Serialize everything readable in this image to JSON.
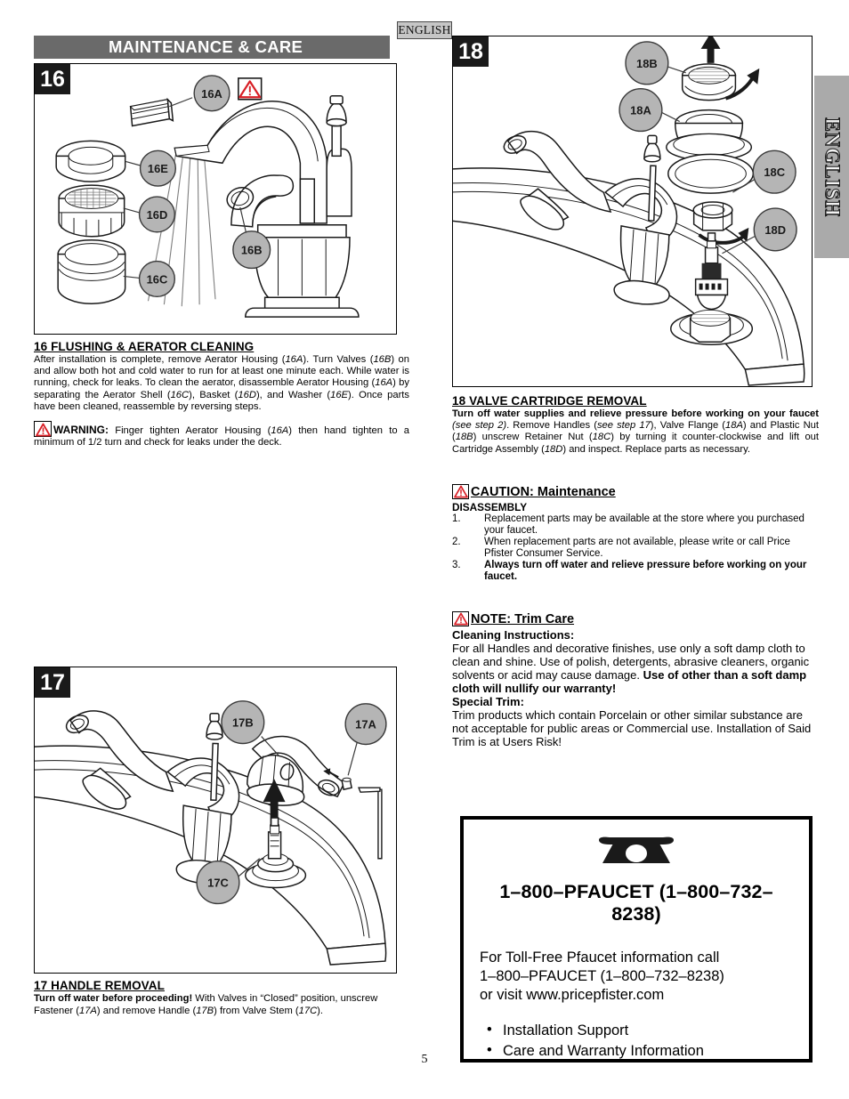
{
  "page": {
    "number": "5",
    "language_tab_top": "ENGLISH",
    "language_tab_side": "ENGLISH"
  },
  "header": {
    "title": "MAINTENANCE & CARE"
  },
  "figures": {
    "fig16": {
      "number": "16",
      "callouts": [
        "16A",
        "16E",
        "16D",
        "16C",
        "16B"
      ],
      "warning_icon": "warning-triangle-icon"
    },
    "fig17": {
      "number": "17",
      "callouts": [
        "17B",
        "17A",
        "17C"
      ]
    },
    "fig18": {
      "number": "18",
      "callouts": [
        "18B",
        "18A",
        "18C",
        "18D"
      ]
    }
  },
  "sections": {
    "s16": {
      "title": "16  FLUSHING & AERATOR CLEANING",
      "body_1": "After installation is complete, remove Aerator Housing (",
      "ref_16a_1": "16A",
      "body_2": "). Turn Valves (",
      "ref_16b": "16B",
      "body_3": ") on and allow both hot and cold water to run for at least one minute each.  While water is running, check for leaks.  To clean the aerator, disassemble Aerator Housing (",
      "ref_16a_2": "16A",
      "body_4": ") by separating the Aerator Shell (",
      "ref_16c": "16C",
      "body_5": "), Basket (",
      "ref_16d": "16D",
      "body_6": "), and Washer (",
      "ref_16e": "16E",
      "body_7": ").  Once parts have been cleaned, reassemble by reversing steps.",
      "warning_label": "WARNING:",
      "warning_1": " Finger tighten Aerator Housing (",
      "warning_ref": "16A",
      "warning_2": ") then hand tighten to a minimum of 1/2 turn and check for leaks under the deck."
    },
    "s17": {
      "title": "17  HANDLE REMOVAL",
      "bold_lead": "Turn off water before proceeding!",
      "body_1": "  With Valves in “Closed” position, unscrew Fastener (",
      "ref_17a": "17A",
      "body_2": ") and remove Handle (",
      "ref_17b": "17B",
      "body_3": ") from Valve Stem (",
      "ref_17c": "17C",
      "body_4": ")."
    },
    "s18": {
      "title": "18  VALVE CARTRIDGE REMOVAL",
      "bold_lead": "Turn off water supplies and relieve pressure before working on your faucet",
      "italic_1": " (see step 2)",
      "body_1": ".  Remove Handles (",
      "italic_2": "see step 17",
      "body_2": "), Valve Flange (",
      "ref_18a": "18A",
      "body_3": ") and Plastic Nut (",
      "ref_18b": "18B",
      "body_4": ") unscrew Retainer Nut (",
      "ref_18c": "18C",
      "body_5": ") by turning it counter-clockwise and lift out Cartridge Assembly (",
      "ref_18d": "18D",
      "body_6": ") and inspect.   Replace parts as necessary."
    },
    "caution": {
      "heading": "CAUTION:  Maintenance",
      "subheading": "DISASSEMBLY",
      "items": [
        {
          "num": "1.",
          "text": "Replacement parts may be available at the store where you purchased your faucet.",
          "bold": false
        },
        {
          "num": "2.",
          "text": "When replacement parts are not available, please write or call Price Pfister Consumer Service.",
          "bold": false
        },
        {
          "num": "3.",
          "text": "Always turn off water and relieve pressure before working on your faucet.",
          "bold": true
        }
      ]
    },
    "note": {
      "heading": "NOTE:  Trim Care",
      "sub1": "Cleaning Instructions:",
      "para1_a": "For all Handles and decorative finishes, use only a soft damp cloth to clean and shine.  Use of polish, detergents, abrasive cleaners, organic solvents or acid may cause damage.  ",
      "para1_b": "Use of other than a soft damp cloth will nullify our warranty!",
      "sub2": "Special Trim:",
      "para2": "Trim products which contain Porcelain or other similar substance are not acceptable for public areas or Commercial use.  Installation of Said Trim is at Users Risk!"
    }
  },
  "phone_box": {
    "icon": "telephone-icon",
    "number_headline": "1–800–PFAUCET (1–800–732–8238)",
    "line1": "For Toll-Free Pfaucet information call",
    "line2": "1–800–PFAUCET (1–800–732–8238)",
    "line3": "or visit www.pricepfister.com",
    "bullet1": "Installation Support",
    "bullet2": "Care and Warranty Information",
    "bullet_glyph": "•"
  },
  "colors": {
    "header_bar": "#6a6a6a",
    "fig_number_badge": "#1a1a1a",
    "callout_fill": "#b5b5b5",
    "tab_side": "#aaaaaa",
    "tab_top": "#c6c6c6",
    "warning_red": "#d81f26"
  }
}
